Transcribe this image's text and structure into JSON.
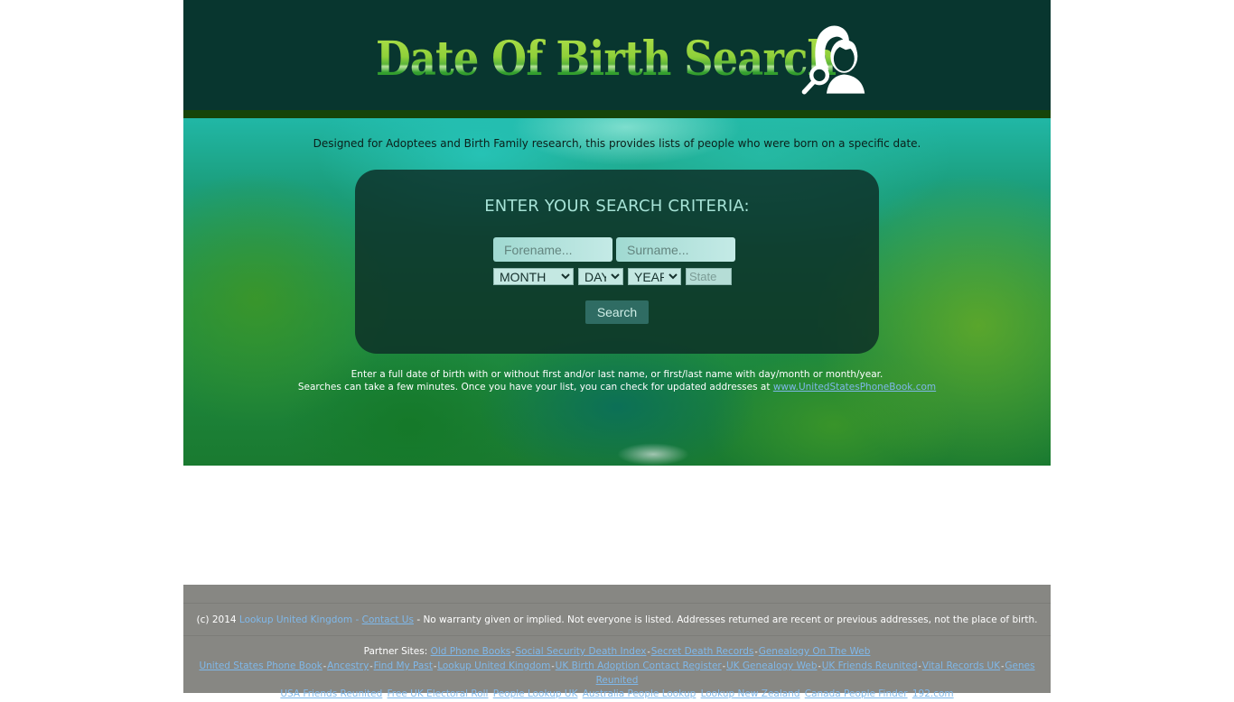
{
  "header": {
    "logo_text": "Date Of Birth Search",
    "logo_icon": "people-search-icon"
  },
  "intro": "Designed for Adoptees and Birth Family research, this provides lists of people who were born on a specific date.",
  "search": {
    "title": "ENTER YOUR SEARCH CRITERIA:",
    "forename_placeholder": "Forename...",
    "surname_placeholder": "Surname...",
    "month_selected": "MONTH",
    "day_selected": "DAY",
    "year_selected": "YEAR",
    "state_placeholder": "State",
    "button_label": "Search"
  },
  "help": {
    "line1": "Enter a full date of birth with or without first and/or last name, or first/last name with day/month or month/year.",
    "line2": "Searches can take a few minutes. Once you have your list, you can check for updated addresses at",
    "link": "www.UnitedStatesPhoneBook.com"
  },
  "footer": {
    "copyright": "(c) 2014",
    "site_link": "Lookup United Kingdom",
    "dash": "-",
    "contact_link": "Contact Us",
    "disclaimer": "- No warranty given or implied. Not everyone is listed. Addresses returned are recent or previous addresses, not the place of birth.",
    "partners_label": "Partner Sites:",
    "partner_rows": [
      [
        "Old Phone Books",
        "Social Security Death Index",
        "Secret Death Records",
        "Genealogy On The Web"
      ],
      [
        "United States Phone Book",
        "Ancestry",
        "Find My Past",
        "Lookup United Kingdom",
        "UK Birth Adoption Contact Register",
        "UK Genealogy Web",
        "UK Friends Reunited",
        "Vital Records UK",
        "Genes Reunited"
      ],
      [
        "USA Friends Reunited",
        "Free UK Electoral Roll",
        "People Lookup UK",
        "Australia People Lookup",
        "Lookup New Zealand",
        "Canada People Finder",
        "192.com"
      ]
    ]
  },
  "colors": {
    "header_bg": "#08362f",
    "header_bar": "#164409",
    "footer_bg": "#878783",
    "link": "#7fb8ea"
  }
}
